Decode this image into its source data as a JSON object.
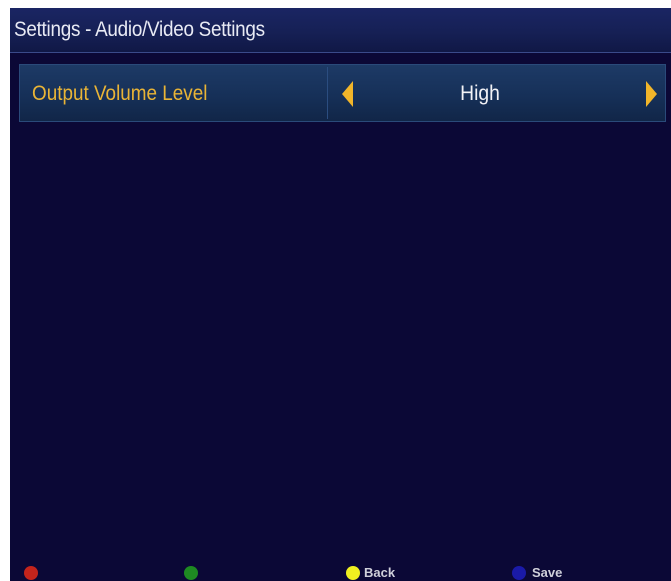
{
  "header": {
    "title": "Settings - Audio/Video Settings"
  },
  "settings": [
    {
      "label": "Output Volume Level",
      "value": "High"
    }
  ],
  "footer": {
    "keys": [
      {
        "color": "#c4241c",
        "icon": "red-key-icon",
        "label": ""
      },
      {
        "color": "#1e8a22",
        "icon": "green-key-icon",
        "label": ""
      },
      {
        "color": "#f0f020",
        "icon": "yellow-key-icon",
        "label": "Back"
      },
      {
        "color": "#1a1aa8",
        "icon": "blue-key-icon",
        "label": "Save"
      }
    ]
  },
  "colors": {
    "background": "#0b0836",
    "label": "#e9b436",
    "arrow": "#f1b52a",
    "value": "#f2f2f6"
  }
}
